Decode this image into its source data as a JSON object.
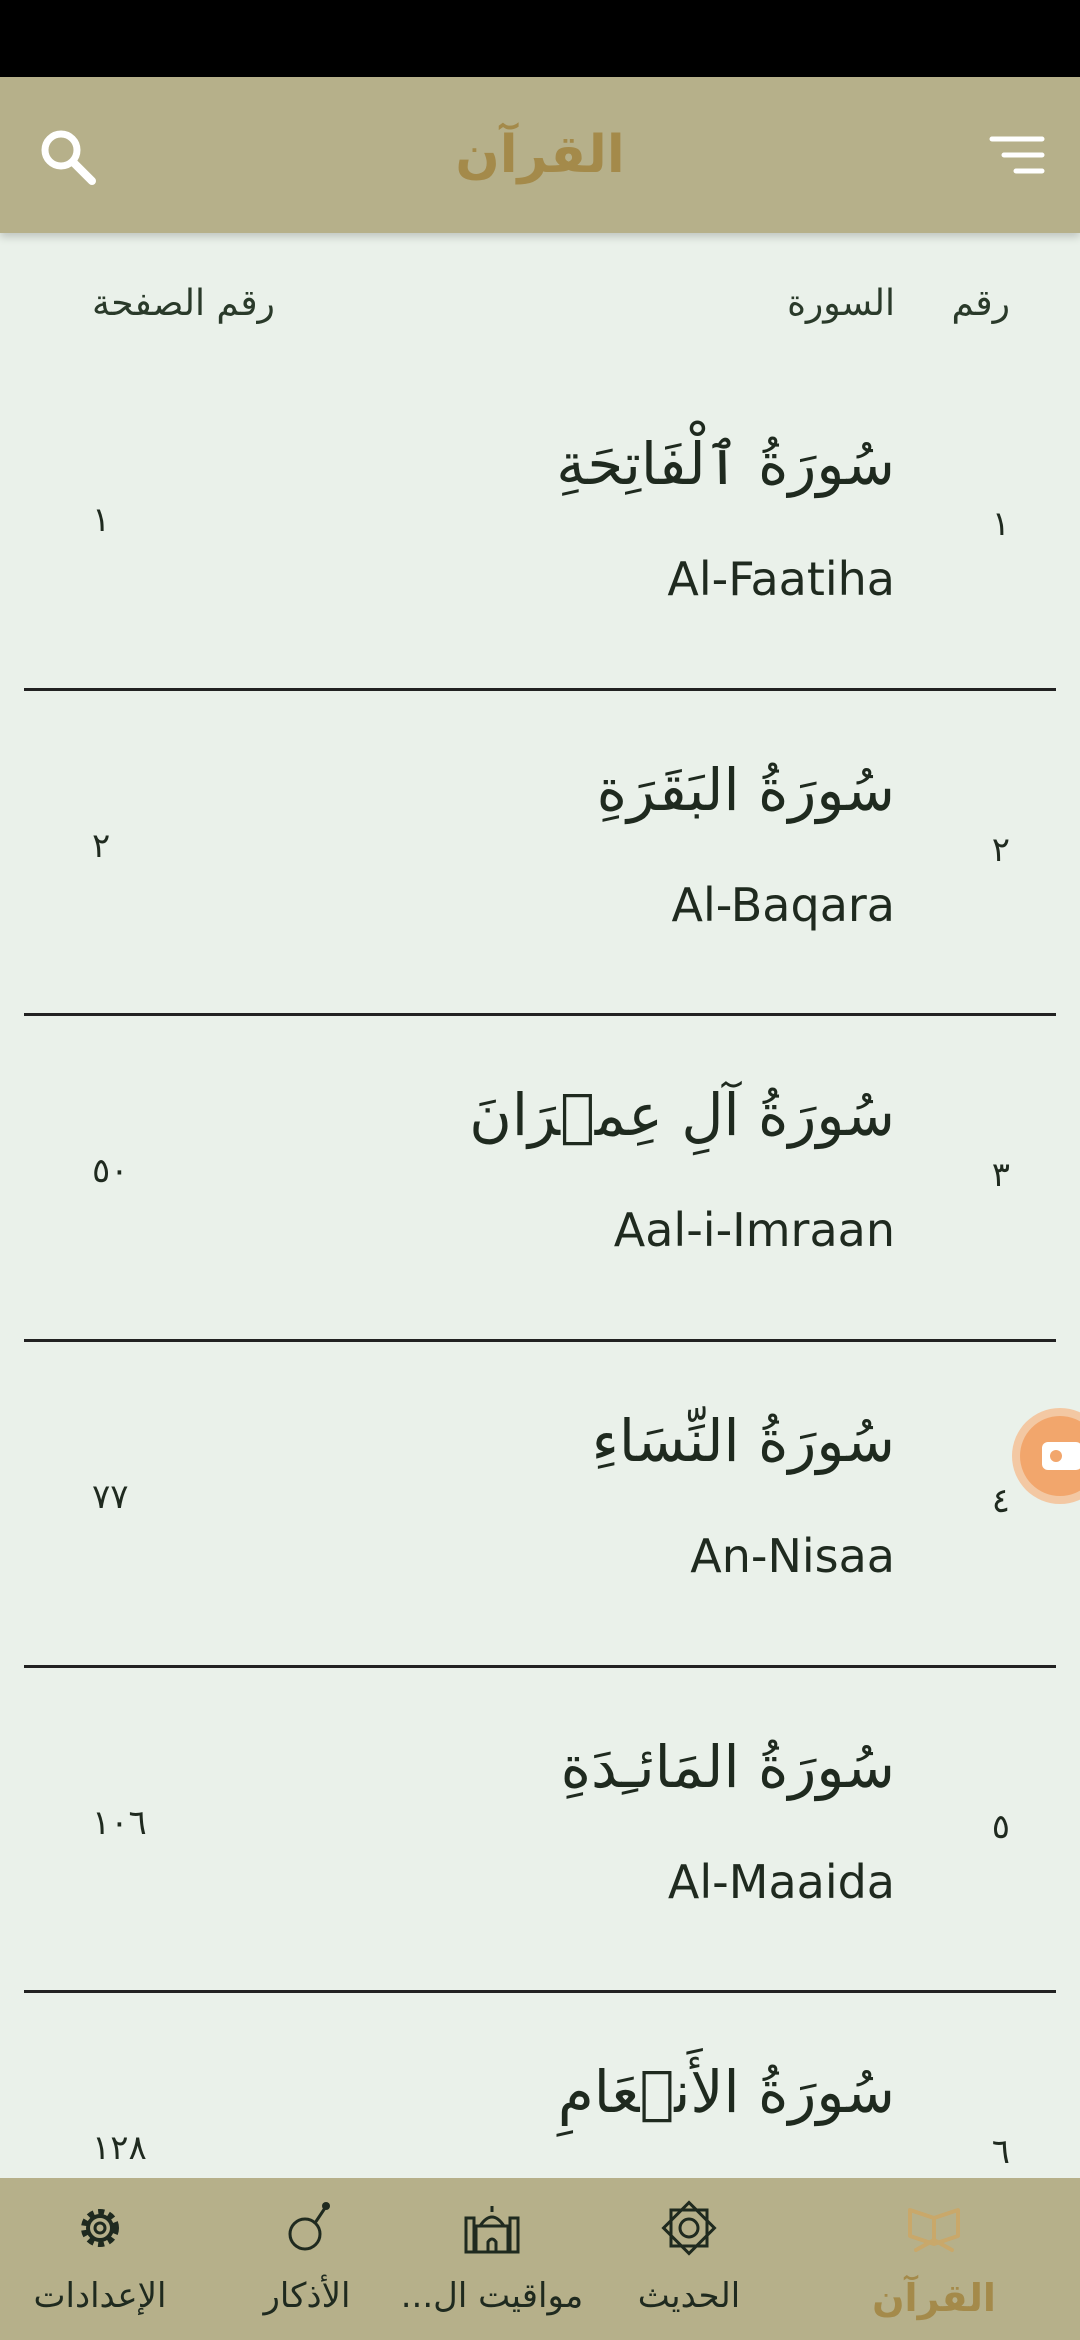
{
  "app_bar": {
    "title": "القرآن"
  },
  "columns": {
    "number": "رقم",
    "surah": "السورة",
    "page": "رقم الصفحة"
  },
  "surahs": [
    {
      "number": "١",
      "arabic": "سُورَةُ ٱلْفَاتِحَةِ",
      "latin": "Al-Faatiha",
      "page": "١"
    },
    {
      "number": "٢",
      "arabic": "سُورَةُ البَقَرَةِ",
      "latin": "Al-Baqara",
      "page": "٢"
    },
    {
      "number": "٣",
      "arabic": "سُورَةُ آلِ عِمۡرَانَ",
      "latin": "Aal-i-Imraan",
      "page": "٥٠"
    },
    {
      "number": "٤",
      "arabic": "سُورَةُ النِّسَاءِ",
      "latin": "An-Nisaa",
      "page": "٧٧"
    },
    {
      "number": "٥",
      "arabic": "سُورَةُ المَائـِدَةِ",
      "latin": "Al-Maaida",
      "page": "١٠٦"
    },
    {
      "number": "٦",
      "arabic": "سُورَةُ الأَنۡعَامِ",
      "latin": "",
      "page": "١٢٨"
    }
  ],
  "bottom_nav": [
    {
      "label": "القرآن",
      "icon": "quran-book-icon",
      "active": true
    },
    {
      "label": "الحديث",
      "icon": "star-octagon-icon",
      "active": false
    },
    {
      "label": "مواقيت ال...",
      "icon": "mosque-icon",
      "active": false
    },
    {
      "label": "الأذكار",
      "icon": "prayer-beads-icon",
      "active": false
    },
    {
      "label": "الإعدادات",
      "icon": "gear-icon",
      "active": false
    }
  ],
  "colors": {
    "app_bar": "#b6b08a",
    "accent": "#a48a4a",
    "background": "#eaf1ea",
    "fab": "#f2a66c"
  }
}
